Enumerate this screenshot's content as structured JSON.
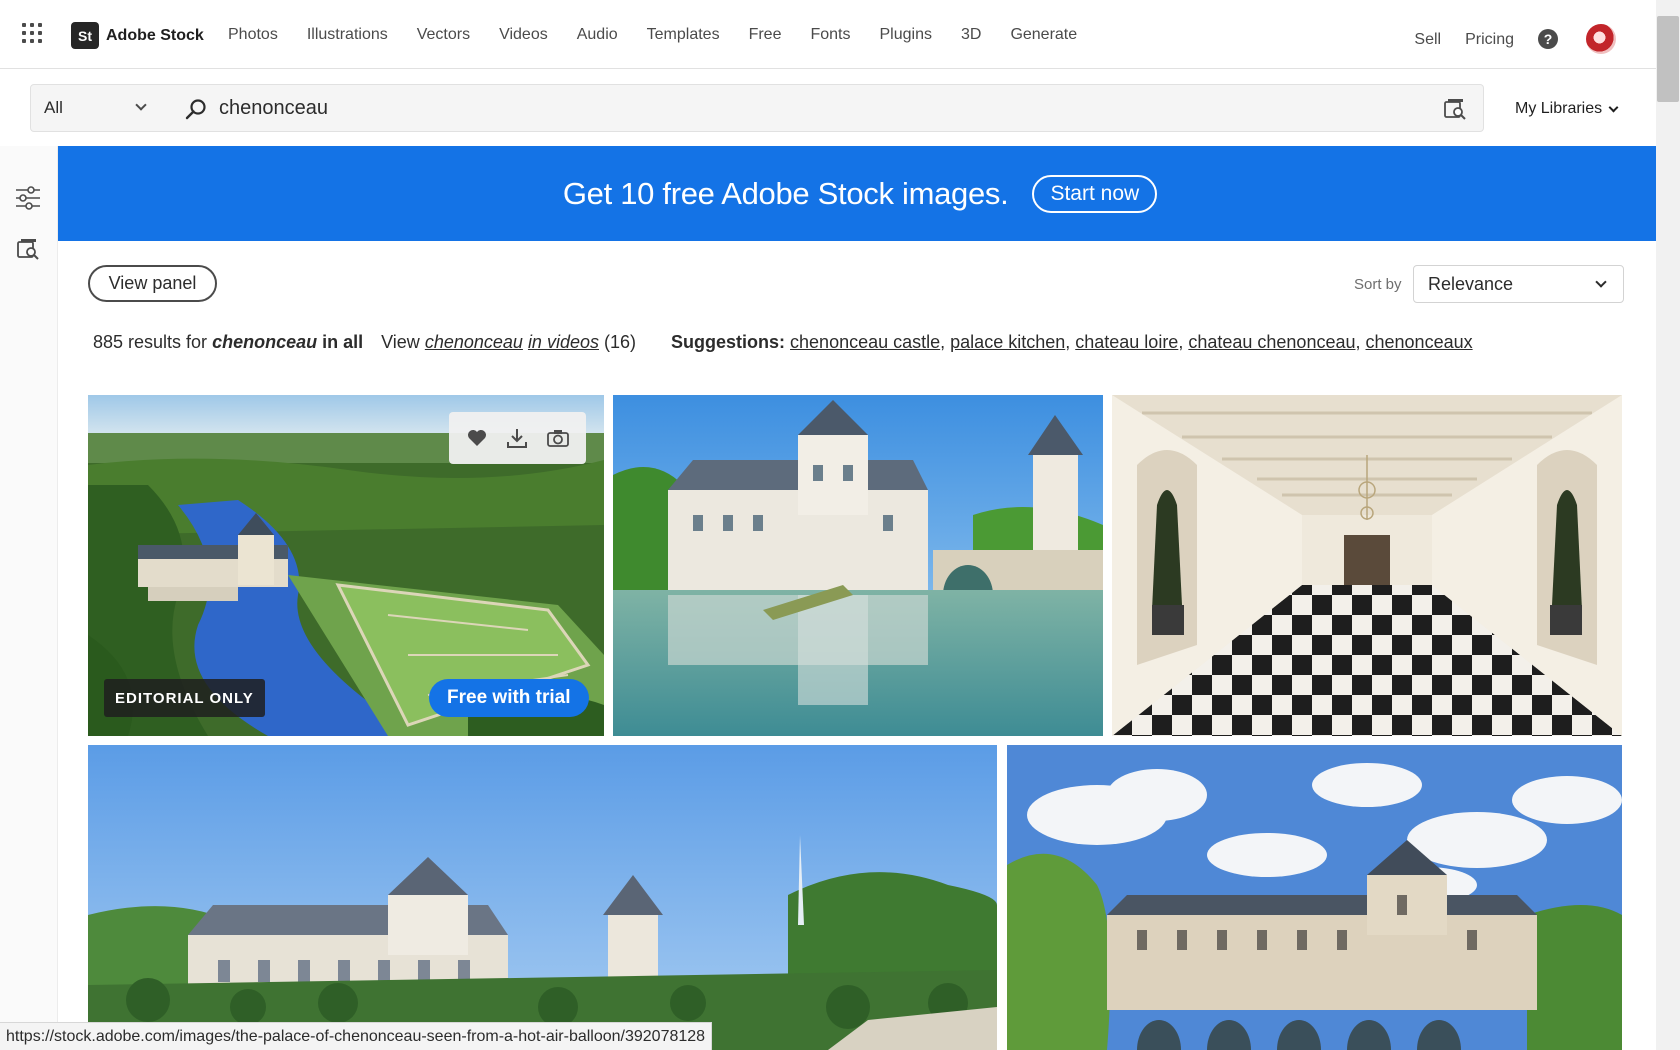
{
  "brand": {
    "logo": "St",
    "name": "Adobe Stock"
  },
  "nav": {
    "links": [
      "Photos",
      "Illustrations",
      "Vectors",
      "Videos",
      "Audio",
      "Templates",
      "Free",
      "Fonts",
      "Plugins",
      "3D",
      "Generate"
    ],
    "sell": "Sell",
    "pricing": "Pricing",
    "help": "?"
  },
  "search": {
    "scope": "All",
    "query": "chenonceau",
    "libraries": "My Libraries"
  },
  "banner": {
    "text": "Get 10 free Adobe Stock images.",
    "button": "Start now",
    "color": "#1473e6"
  },
  "controls": {
    "view_panel": "View panel",
    "sort_label": "Sort by",
    "sort_value": "Relevance"
  },
  "results": {
    "count_text": "885 results for",
    "query": "chenonceau",
    "scope_text": "in all",
    "videos_prefix": "View",
    "videos_query": "chenonceau",
    "videos_mid": "in videos",
    "videos_count": "(16)",
    "suggestions_label": "Suggestions:",
    "suggestions": [
      "chenonceau castle",
      "palace kitchen",
      "chateau loire",
      "chateau chenonceau",
      "chenonceaux"
    ]
  },
  "tiles": [
    {
      "name": "aerial-chateau-gardens",
      "badge": "EDITORIAL ONLY",
      "trial": "Free with trial"
    },
    {
      "name": "chateau-river-reflection"
    },
    {
      "name": "gallery-checkered-floor"
    },
    {
      "name": "chateau-garden-panorama"
    },
    {
      "name": "chateau-cloudy-sky"
    }
  ],
  "overlay_icons": [
    "heart-icon",
    "download-icon",
    "camera-icon"
  ],
  "status_url": "https://stock.adobe.com/images/the-palace-of-chenonceau-seen-from-a-hot-air-balloon/392078128"
}
